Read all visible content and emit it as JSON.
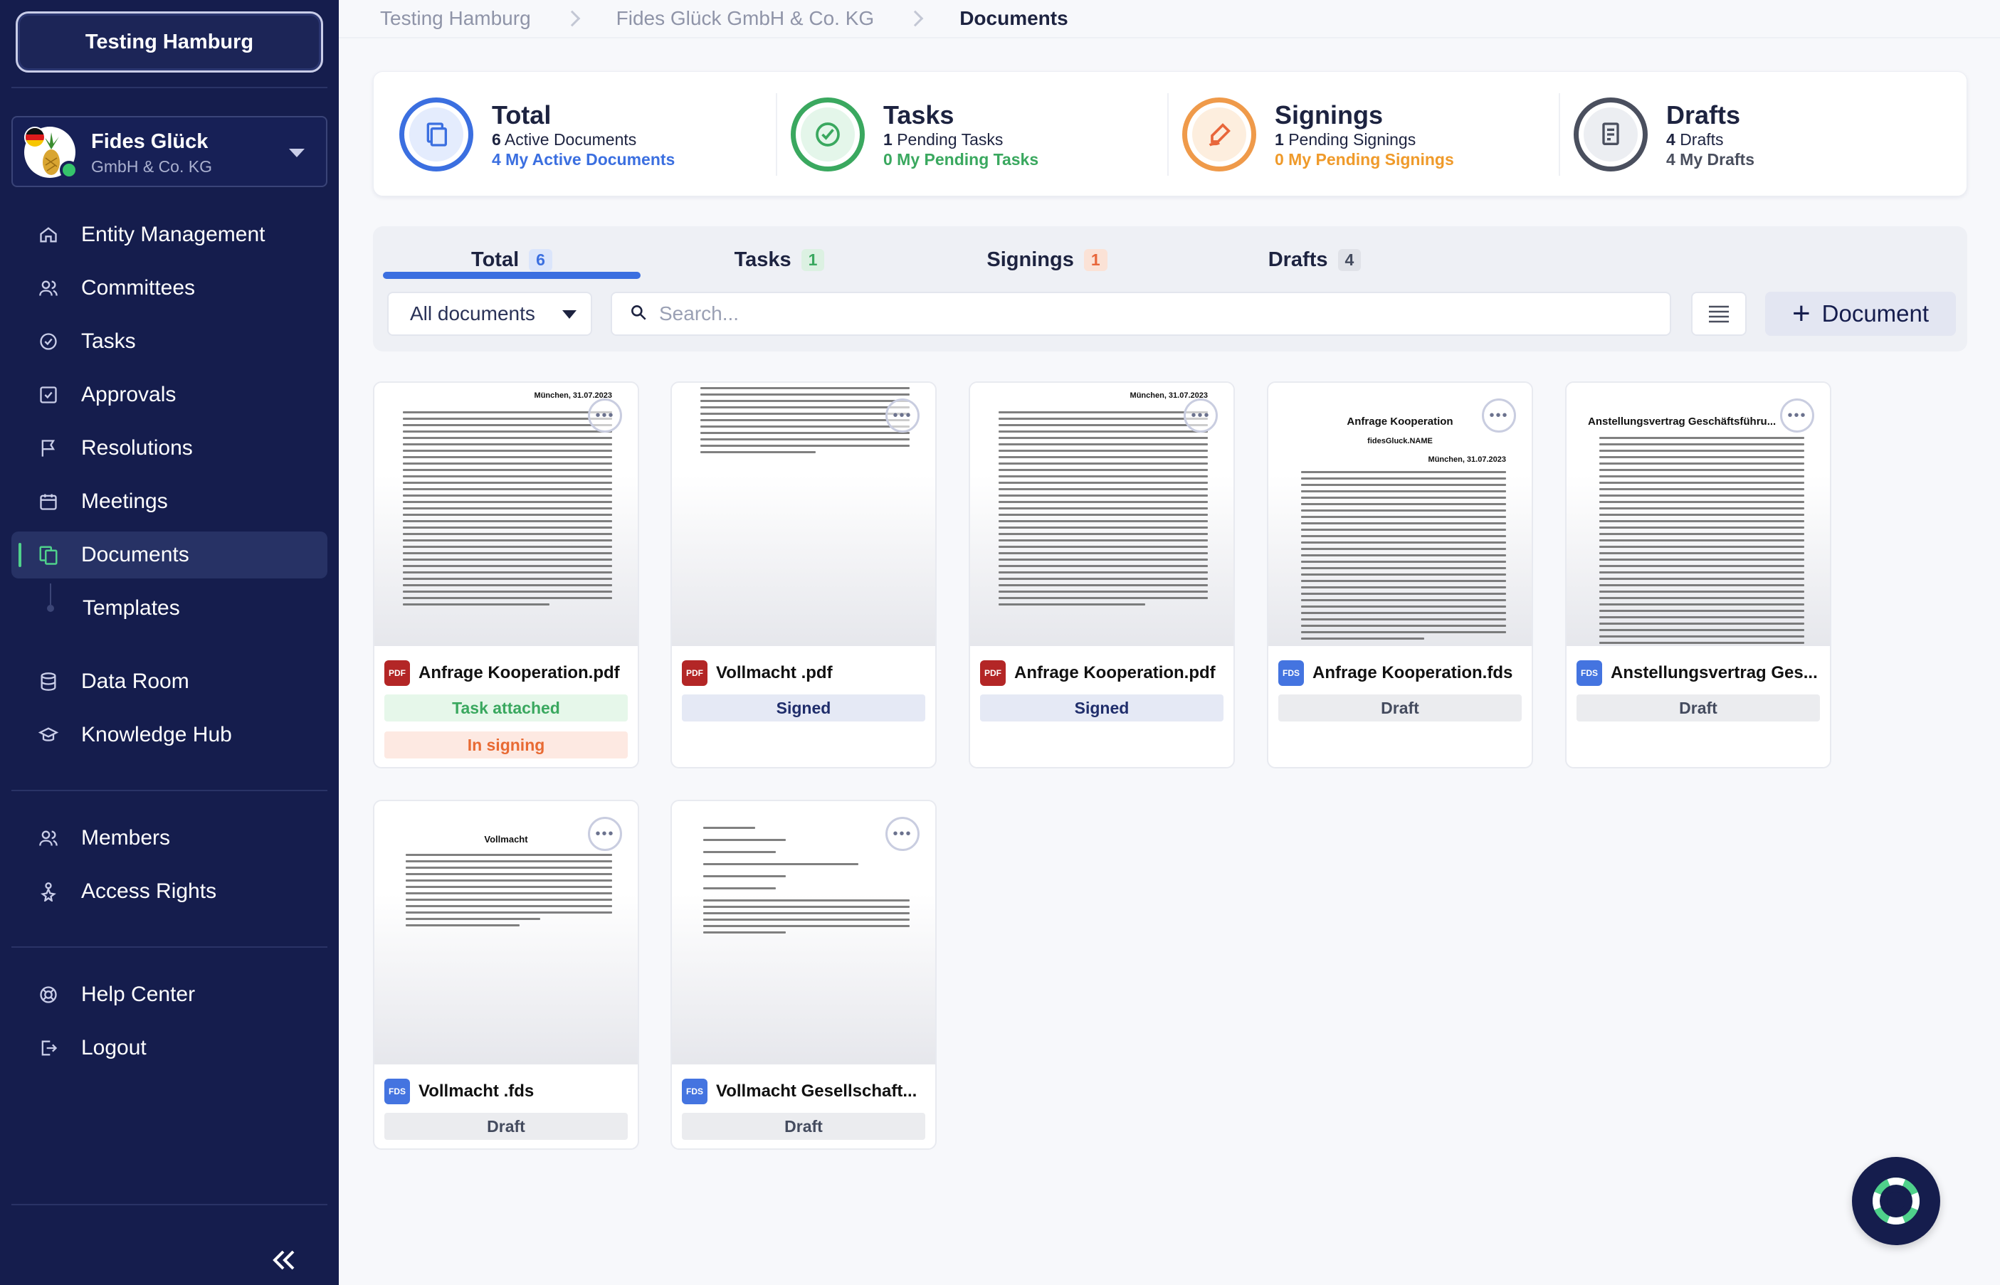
{
  "sidebar": {
    "org_button": "Testing Hamburg",
    "entity": {
      "name": "Fides Glück",
      "sub": "GmbH & Co. KG"
    },
    "nav": [
      {
        "label": "Entity Management",
        "icon": "home-icon"
      },
      {
        "label": "Committees",
        "icon": "users-icon"
      },
      {
        "label": "Tasks",
        "icon": "check-circle-icon"
      },
      {
        "label": "Approvals",
        "icon": "check-square-icon"
      },
      {
        "label": "Resolutions",
        "icon": "flag-icon"
      },
      {
        "label": "Meetings",
        "icon": "calendar-icon"
      },
      {
        "label": "Documents",
        "icon": "documents-icon",
        "active": true
      },
      {
        "label": "Templates",
        "icon": ""
      },
      {
        "label": "Data Room",
        "icon": "database-icon"
      },
      {
        "label": "Knowledge Hub",
        "icon": "graduation-cap-icon"
      },
      {
        "label": "Members",
        "icon": "users-icon"
      },
      {
        "label": "Access Rights",
        "icon": "person-star-icon"
      },
      {
        "label": "Help Center",
        "icon": "lifebuoy-icon"
      },
      {
        "label": "Logout",
        "icon": "logout-icon"
      }
    ],
    "collapse_icon": "double-chevron-left-icon"
  },
  "breadcrumb": [
    "Testing Hamburg",
    "Fides Glück GmbH & Co. KG",
    "Documents"
  ],
  "stats": [
    {
      "title": "Total",
      "count": "6",
      "line1": "Active Documents",
      "line2": "4 My Active Documents",
      "color": "#3b6fe0",
      "icon": "documents-icon"
    },
    {
      "title": "Tasks",
      "count": "1",
      "line1": "Pending Tasks",
      "line2": "0 My Pending Tasks",
      "color": "#3aa85f",
      "icon": "check-circle-icon"
    },
    {
      "title": "Signings",
      "count": "1",
      "line1": "Pending Signings",
      "line2": "0 My Pending Signings",
      "color": "#e8893a",
      "icon": "signature-pen-icon"
    },
    {
      "title": "Drafts",
      "count": "4",
      "line1": "Drafts",
      "line2": "4 My Drafts",
      "color": "#4a4f5e",
      "icon": "draft-document-icon"
    }
  ],
  "tabs": [
    {
      "label": "Total",
      "count": "6",
      "active": true
    },
    {
      "label": "Tasks",
      "count": "1"
    },
    {
      "label": "Signings",
      "count": "1"
    },
    {
      "label": "Drafts",
      "count": "4"
    }
  ],
  "filter": {
    "value": "All documents"
  },
  "search": {
    "placeholder": "Search..."
  },
  "add_button": "Document",
  "documents": [
    {
      "name": "Anfrage Kooperation.pdf",
      "type": "PDF",
      "status": [
        "Task attached",
        "In signing"
      ],
      "preview_date": "München, 31.07.2023"
    },
    {
      "name": "Vollmacht .pdf",
      "type": "PDF",
      "status": [
        "Signed"
      ]
    },
    {
      "name": "Anfrage Kooperation.pdf",
      "type": "PDF",
      "status": [
        "Signed"
      ],
      "preview_date": "München, 31.07.2023"
    },
    {
      "name": "Anfrage Kooperation.fds",
      "type": "FDS",
      "status": [
        "Draft"
      ],
      "preview_title": "Anfrage Kooperation",
      "preview_sub": "fidesGluck.NAME",
      "preview_date": "München, 31.07.2023"
    },
    {
      "name": "Anstellungsvertrag Ges...",
      "type": "FDS",
      "status": [
        "Draft"
      ],
      "preview_title": "Anstellungsvertrag Geschäftsführu..."
    },
    {
      "name": "Vollmacht .fds",
      "type": "FDS",
      "status": [
        "Draft"
      ],
      "preview_title": "Vollmacht"
    },
    {
      "name": "Vollmacht Gesellschaft...",
      "type": "FDS",
      "status": [
        "Draft"
      ]
    }
  ]
}
